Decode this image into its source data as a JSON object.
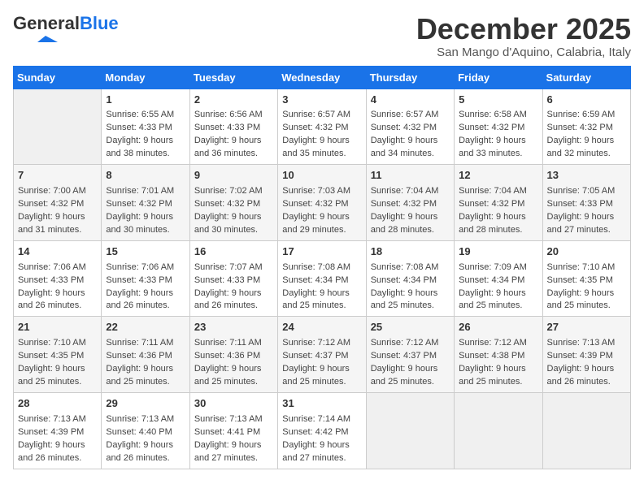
{
  "header": {
    "logo_general": "General",
    "logo_blue": "Blue",
    "month_title": "December 2025",
    "subtitle": "San Mango d'Aquino, Calabria, Italy"
  },
  "weekdays": [
    "Sunday",
    "Monday",
    "Tuesday",
    "Wednesday",
    "Thursday",
    "Friday",
    "Saturday"
  ],
  "weeks": [
    [
      {
        "day": "",
        "content": ""
      },
      {
        "day": "1",
        "content": "Sunrise: 6:55 AM\nSunset: 4:33 PM\nDaylight: 9 hours\nand 38 minutes."
      },
      {
        "day": "2",
        "content": "Sunrise: 6:56 AM\nSunset: 4:33 PM\nDaylight: 9 hours\nand 36 minutes."
      },
      {
        "day": "3",
        "content": "Sunrise: 6:57 AM\nSunset: 4:32 PM\nDaylight: 9 hours\nand 35 minutes."
      },
      {
        "day": "4",
        "content": "Sunrise: 6:57 AM\nSunset: 4:32 PM\nDaylight: 9 hours\nand 34 minutes."
      },
      {
        "day": "5",
        "content": "Sunrise: 6:58 AM\nSunset: 4:32 PM\nDaylight: 9 hours\nand 33 minutes."
      },
      {
        "day": "6",
        "content": "Sunrise: 6:59 AM\nSunset: 4:32 PM\nDaylight: 9 hours\nand 32 minutes."
      }
    ],
    [
      {
        "day": "7",
        "content": "Sunrise: 7:00 AM\nSunset: 4:32 PM\nDaylight: 9 hours\nand 31 minutes."
      },
      {
        "day": "8",
        "content": "Sunrise: 7:01 AM\nSunset: 4:32 PM\nDaylight: 9 hours\nand 30 minutes."
      },
      {
        "day": "9",
        "content": "Sunrise: 7:02 AM\nSunset: 4:32 PM\nDaylight: 9 hours\nand 30 minutes."
      },
      {
        "day": "10",
        "content": "Sunrise: 7:03 AM\nSunset: 4:32 PM\nDaylight: 9 hours\nand 29 minutes."
      },
      {
        "day": "11",
        "content": "Sunrise: 7:04 AM\nSunset: 4:32 PM\nDaylight: 9 hours\nand 28 minutes."
      },
      {
        "day": "12",
        "content": "Sunrise: 7:04 AM\nSunset: 4:32 PM\nDaylight: 9 hours\nand 28 minutes."
      },
      {
        "day": "13",
        "content": "Sunrise: 7:05 AM\nSunset: 4:33 PM\nDaylight: 9 hours\nand 27 minutes."
      }
    ],
    [
      {
        "day": "14",
        "content": "Sunrise: 7:06 AM\nSunset: 4:33 PM\nDaylight: 9 hours\nand 26 minutes."
      },
      {
        "day": "15",
        "content": "Sunrise: 7:06 AM\nSunset: 4:33 PM\nDaylight: 9 hours\nand 26 minutes."
      },
      {
        "day": "16",
        "content": "Sunrise: 7:07 AM\nSunset: 4:33 PM\nDaylight: 9 hours\nand 26 minutes."
      },
      {
        "day": "17",
        "content": "Sunrise: 7:08 AM\nSunset: 4:34 PM\nDaylight: 9 hours\nand 25 minutes."
      },
      {
        "day": "18",
        "content": "Sunrise: 7:08 AM\nSunset: 4:34 PM\nDaylight: 9 hours\nand 25 minutes."
      },
      {
        "day": "19",
        "content": "Sunrise: 7:09 AM\nSunset: 4:34 PM\nDaylight: 9 hours\nand 25 minutes."
      },
      {
        "day": "20",
        "content": "Sunrise: 7:10 AM\nSunset: 4:35 PM\nDaylight: 9 hours\nand 25 minutes."
      }
    ],
    [
      {
        "day": "21",
        "content": "Sunrise: 7:10 AM\nSunset: 4:35 PM\nDaylight: 9 hours\nand 25 minutes."
      },
      {
        "day": "22",
        "content": "Sunrise: 7:11 AM\nSunset: 4:36 PM\nDaylight: 9 hours\nand 25 minutes."
      },
      {
        "day": "23",
        "content": "Sunrise: 7:11 AM\nSunset: 4:36 PM\nDaylight: 9 hours\nand 25 minutes."
      },
      {
        "day": "24",
        "content": "Sunrise: 7:12 AM\nSunset: 4:37 PM\nDaylight: 9 hours\nand 25 minutes."
      },
      {
        "day": "25",
        "content": "Sunrise: 7:12 AM\nSunset: 4:37 PM\nDaylight: 9 hours\nand 25 minutes."
      },
      {
        "day": "26",
        "content": "Sunrise: 7:12 AM\nSunset: 4:38 PM\nDaylight: 9 hours\nand 25 minutes."
      },
      {
        "day": "27",
        "content": "Sunrise: 7:13 AM\nSunset: 4:39 PM\nDaylight: 9 hours\nand 26 minutes."
      }
    ],
    [
      {
        "day": "28",
        "content": "Sunrise: 7:13 AM\nSunset: 4:39 PM\nDaylight: 9 hours\nand 26 minutes."
      },
      {
        "day": "29",
        "content": "Sunrise: 7:13 AM\nSunset: 4:40 PM\nDaylight: 9 hours\nand 26 minutes."
      },
      {
        "day": "30",
        "content": "Sunrise: 7:13 AM\nSunset: 4:41 PM\nDaylight: 9 hours\nand 27 minutes."
      },
      {
        "day": "31",
        "content": "Sunrise: 7:14 AM\nSunset: 4:42 PM\nDaylight: 9 hours\nand 27 minutes."
      },
      {
        "day": "",
        "content": ""
      },
      {
        "day": "",
        "content": ""
      },
      {
        "day": "",
        "content": ""
      }
    ]
  ]
}
